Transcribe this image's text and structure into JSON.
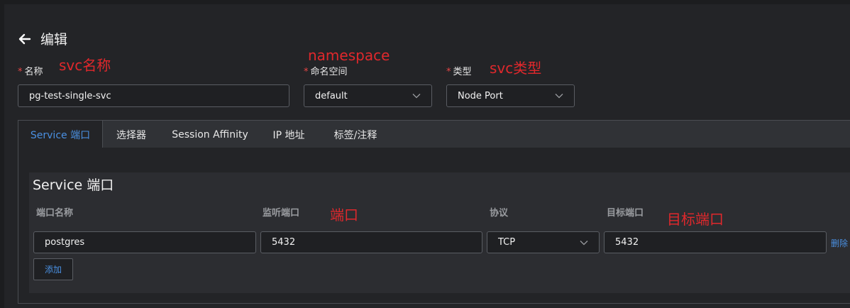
{
  "header": {
    "title": "编辑"
  },
  "annotations": {
    "name": "svc名称",
    "namespace": "namespace",
    "type": "svc类型",
    "port": "端口",
    "target_port": "目标端口"
  },
  "form": {
    "required_mark": "*",
    "name": {
      "label": "名称",
      "value": "pg-test-single-svc"
    },
    "namespace": {
      "label": "命名空间",
      "value": "default"
    },
    "type": {
      "label": "类型",
      "value": "Node Port"
    }
  },
  "tabs": [
    {
      "label": "Service 端口",
      "active": true
    },
    {
      "label": "选择器",
      "active": false
    },
    {
      "label": "Session Affinity",
      "active": false
    },
    {
      "label": "IP 地址",
      "active": false
    },
    {
      "label": "标签/注释",
      "active": false
    }
  ],
  "ports_section": {
    "title": "Service 端口",
    "columns": [
      "端口名称",
      "监听端口",
      "协议",
      "目标端口"
    ],
    "rows": [
      {
        "name": "postgres",
        "port": "5432",
        "protocol": "TCP",
        "target_port": "5432",
        "delete_label": "删除"
      }
    ],
    "add_label": "添加"
  },
  "colors": {
    "accent": "#4a90e2",
    "annotation": "#e0282c",
    "required": "#e64545",
    "background": "#1c1d1f"
  }
}
